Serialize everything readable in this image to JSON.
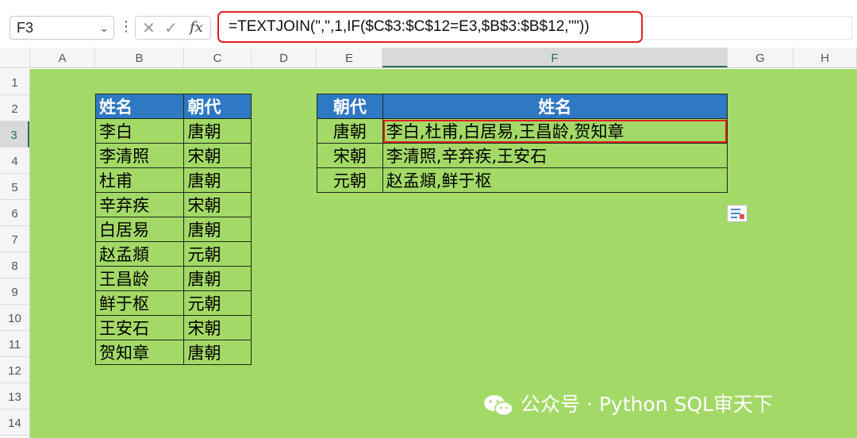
{
  "namebox": {
    "value": "F3"
  },
  "formula_bar": {
    "fx_label": "fx",
    "formula": "=TEXTJOIN(\",\",1,IF($C$3:$C$12=E3,$B$3:$B$12,\"\"))"
  },
  "columns": [
    "A",
    "B",
    "C",
    "D",
    "E",
    "F",
    "G",
    "H"
  ],
  "rows": [
    "1",
    "2",
    "3",
    "4",
    "5",
    "6",
    "7",
    "8",
    "9",
    "10",
    "11",
    "12",
    "13",
    "14"
  ],
  "selected_cell": {
    "column": "F",
    "row": "3"
  },
  "left_table": {
    "headers": [
      "姓名",
      "朝代"
    ],
    "rows": [
      [
        "李白",
        "唐朝"
      ],
      [
        "李清照",
        "宋朝"
      ],
      [
        "杜甫",
        "唐朝"
      ],
      [
        "辛弃疾",
        "宋朝"
      ],
      [
        "白居易",
        "唐朝"
      ],
      [
        "赵孟頫",
        "元朝"
      ],
      [
        "王昌龄",
        "唐朝"
      ],
      [
        "鲜于枢",
        "元朝"
      ],
      [
        "王安石",
        "宋朝"
      ],
      [
        "贺知章",
        "唐朝"
      ]
    ]
  },
  "right_table": {
    "headers": [
      "朝代",
      "姓名"
    ],
    "rows": [
      [
        "唐朝",
        "李白,杜甫,白居易,王昌龄,贺知章"
      ],
      [
        "宋朝",
        "李清照,辛弃疾,王安石"
      ],
      [
        "元朝",
        "赵孟頫,鲜于枢"
      ]
    ]
  },
  "watermark": {
    "text": "公众号 · Python SQL审天下"
  },
  "colors": {
    "sheet_background": "#a3d966",
    "table_header": "#2f78c4",
    "highlight_border": "#e02020",
    "selection_green": "#217346"
  }
}
